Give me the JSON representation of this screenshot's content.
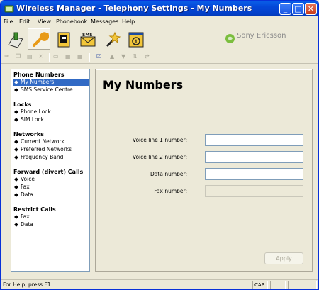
{
  "window": {
    "title": "Wireless Manager - Telephony Settings - My Numbers"
  },
  "menubar": {
    "items": [
      "File",
      "Edit",
      "View",
      "Phonebook",
      "Messages",
      "Help"
    ]
  },
  "toolbar": {
    "buttons": [
      {
        "icon": "phone-connect-icon"
      },
      {
        "icon": "wrench-settings-icon"
      },
      {
        "icon": "phonebook-icon"
      },
      {
        "icon": "sms-envelope-icon"
      },
      {
        "icon": "wizard-wand-icon"
      },
      {
        "icon": "info-icon"
      }
    ],
    "brand": "Sony Ericsson"
  },
  "nav": {
    "groups": [
      {
        "title": "Phone Numbers",
        "items": [
          "My Numbers",
          "SMS Service Centre"
        ]
      },
      {
        "title": "Locks",
        "items": [
          "Phone Lock",
          "SIM Lock"
        ]
      },
      {
        "title": "Networks",
        "items": [
          "Current Network",
          "Preferred Networks",
          "Frequency Band"
        ]
      },
      {
        "title": "Forward (divert) Calls",
        "items": [
          "Voice",
          "Fax",
          "Data"
        ]
      },
      {
        "title": "Restrict Calls",
        "items": [
          "Fax",
          "Data"
        ]
      }
    ],
    "selected": "My Numbers"
  },
  "panel": {
    "title": "My Numbers",
    "fields": [
      {
        "label": "Voice line 1 number:",
        "value": "",
        "enabled": true
      },
      {
        "label": "Voice line 2 number:",
        "value": "",
        "enabled": true
      },
      {
        "label": "Data number:",
        "value": "",
        "enabled": true
      },
      {
        "label": "Fax number:",
        "value": "",
        "enabled": false
      }
    ],
    "apply": "Apply"
  },
  "statusbar": {
    "text": "For Help, press F1",
    "cap": "CAP"
  },
  "colors": {
    "title_bar": "#0447D8",
    "selection": "#316AC5",
    "face": "#ECE9D8"
  }
}
